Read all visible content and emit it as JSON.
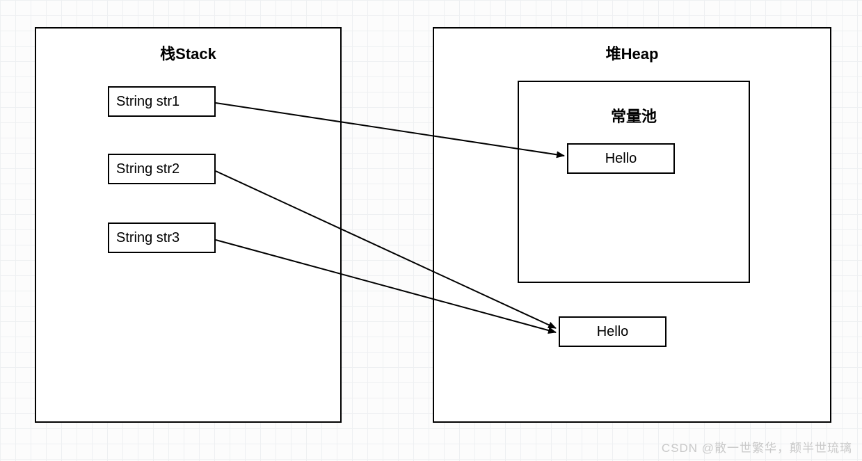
{
  "stack": {
    "title": "栈Stack",
    "items": [
      {
        "label": "String str1"
      },
      {
        "label": "String str2"
      },
      {
        "label": "String str3"
      }
    ]
  },
  "heap": {
    "title": "堆Heap",
    "constant_pool": {
      "title": "常量池",
      "value": "Hello"
    },
    "object_value": "Hello"
  },
  "watermark": "CSDN @散一世繁华，颠半世琉璃"
}
